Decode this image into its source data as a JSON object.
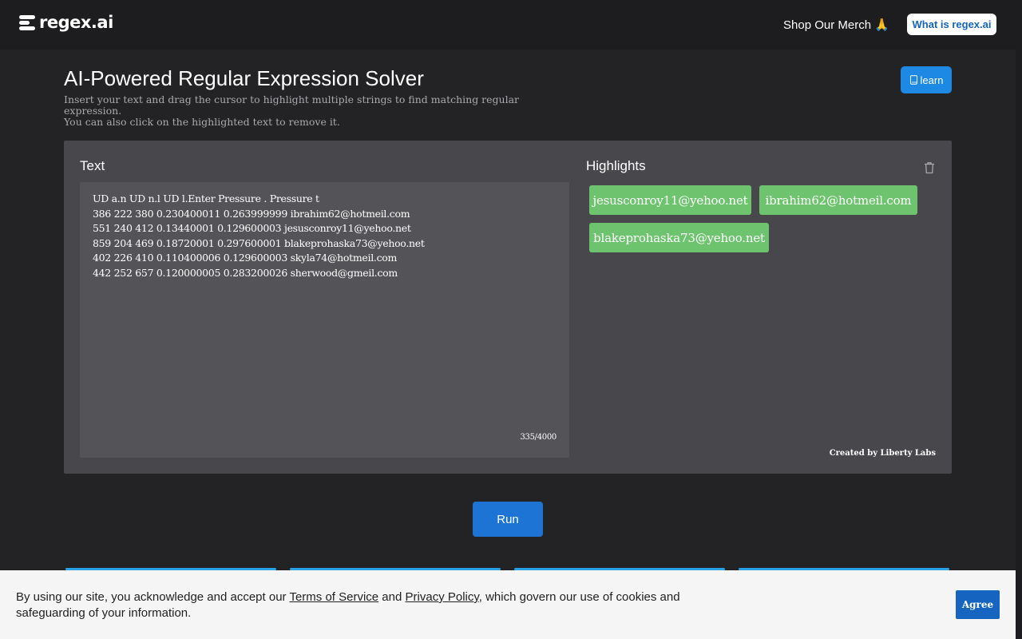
{
  "header": {
    "logo_text": "regex.ai",
    "shop_link": "Shop Our Merch 🙏",
    "what_button": "What is regex.ai"
  },
  "main": {
    "title": "AI-Powered Regular Expression Solver",
    "subtitle_line1": "Insert your text and drag the cursor to highlight multiple strings to find matching regular expression.",
    "subtitle_line2": "You can also click on the highlighted text to remove it.",
    "learn_button": "learn"
  },
  "text_panel": {
    "label": "Text",
    "lines": [
      "UD a.n UD n.l UD l.Enter Pressure . Pressure t",
      "386 222 380 0.230400011 0.263999999 ibrahim62@hotmeil.com",
      "551 240 412 0.13440001 0.129600003 jesusconroy11@yehoo.net",
      "859 204 469 0.18720001 0.297600001 blakeprohaska73@yehoo.net",
      "402 226 410 0.110400006 0.129600003 skyla74@hotmeil.com",
      "442 252 657 0.120000005 0.283200026 sherwood@gmeil.com"
    ],
    "char_count": "335/4000"
  },
  "highlights_panel": {
    "label": "Highlights",
    "chips": [
      "jesusconroy11@yehoo.net",
      "ibrahim62@hotmeil.com",
      "blakeprohaska73@yehoo.net"
    ],
    "credit": "Created by Liberty Labs"
  },
  "run_button": "Run",
  "cookie": {
    "text_before": "By using our site, you acknowledge and accept our ",
    "terms_link": "Terms of Service",
    "text_and": " and ",
    "privacy_link": "Privacy Policy",
    "text_after": ", which govern our use of cookies and safeguarding of your information.",
    "agree_button": "Agree"
  },
  "colors": {
    "background": "#232325",
    "panel": "#48484c",
    "chip": "#6ec46e",
    "accent": "#1e74d4"
  }
}
